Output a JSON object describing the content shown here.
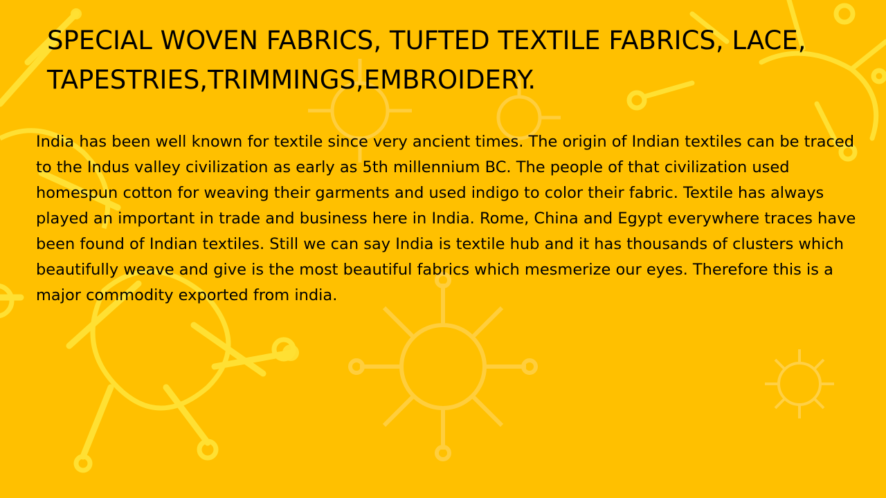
{
  "slide": {
    "title": "SPECIAL WOVEN FABRICS, TUFTED TEXTILE FABRICS, LACE, TAPESTRIES,TRIMMINGS,EMBROIDERY.",
    "body": "India has been well known for textile since very ancient times. The origin of Indian textiles can be traced to the Indus valley civilization as early as 5th millennium BC. The people of that civilization used homespun cotton for weaving their garments and used indigo to color their fabric. Textile has always played an important in trade and business here in India. Rome, China and Egypt everywhere traces have been found of Indian textiles. Still we can say India is textile hub and it has thousands of clusters which beautifully weave and give is the most beautiful fabrics which mesmerize our eyes. Therefore this is a major commodity exported from india."
  },
  "colors": {
    "background": "#ffc000",
    "pattern": "#ffe033",
    "pattern_faint": "#ffd24d",
    "text": "#000000"
  },
  "background_motif": "virus-outline-icon"
}
